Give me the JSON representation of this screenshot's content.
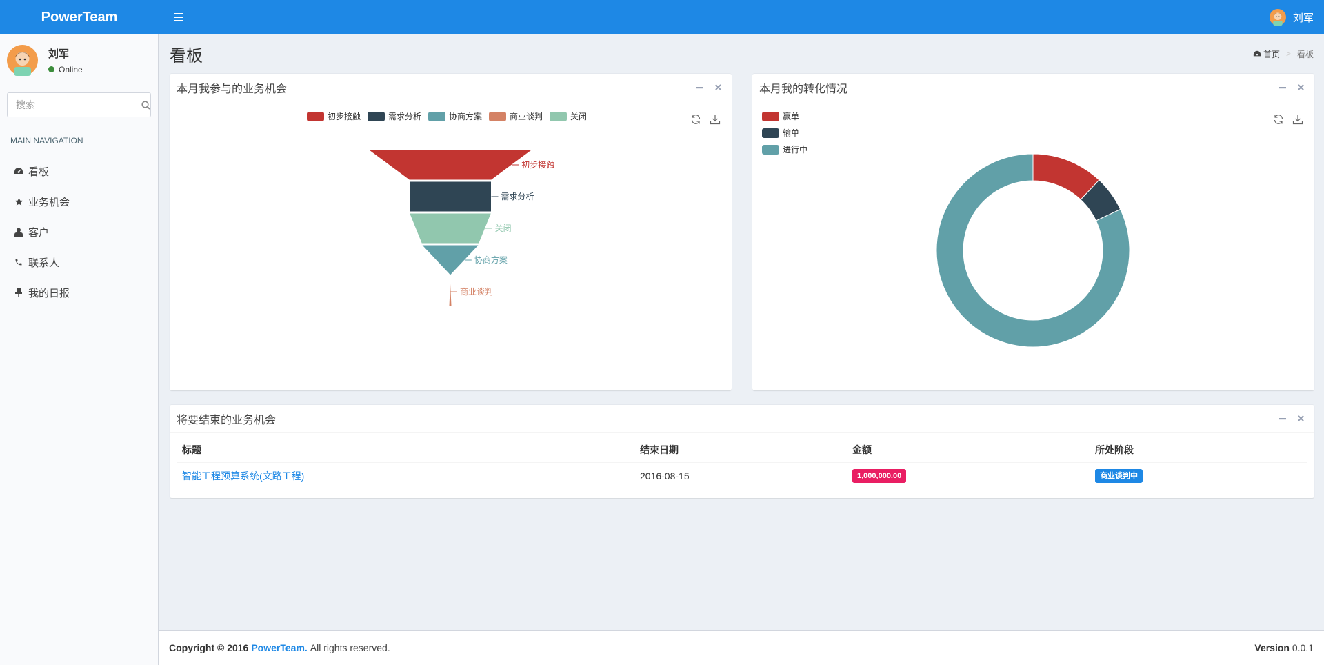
{
  "header": {
    "logo": "PowerTeam",
    "user_name": "刘军"
  },
  "sidebar": {
    "user_name": "刘军",
    "status": "Online",
    "search_placeholder": "搜索",
    "nav_header": "MAIN NAVIGATION",
    "items": [
      {
        "label": "看板",
        "icon": "dashboard-icon"
      },
      {
        "label": "业务机会",
        "icon": "star-icon"
      },
      {
        "label": "客户",
        "icon": "user-icon"
      },
      {
        "label": "联系人",
        "icon": "phone-icon"
      },
      {
        "label": "我的日报",
        "icon": "pin-icon"
      }
    ]
  },
  "content": {
    "title": "看板",
    "breadcrumb_home": "首页",
    "breadcrumb_current": "看板"
  },
  "colors": {
    "primary": "#1e88e5",
    "red": "#c23531",
    "dark": "#2f4554",
    "teal": "#61a0a8",
    "orange": "#d48265",
    "green": "#91c7ae",
    "pink": "#e91e63"
  },
  "funnel_box": {
    "title": "本月我参与的业务机会"
  },
  "donut_box": {
    "title": "本月我的转化情况"
  },
  "chart_data": [
    {
      "type": "funnel",
      "legend": [
        "初步接触",
        "需求分析",
        "协商方案",
        "商业谈判",
        "关闭"
      ],
      "legend_placement": "top-center",
      "stages": [
        {
          "name": "初步接触",
          "value": 100
        },
        {
          "name": "需求分析",
          "value": 50
        },
        {
          "name": "关闭",
          "value": 50
        },
        {
          "name": "协商方案",
          "value": 35
        },
        {
          "name": "商业谈判",
          "value": 0
        }
      ],
      "colors": [
        "#c23531",
        "#2f4554",
        "#91c7ae",
        "#61a0a8",
        "#d48265"
      ]
    },
    {
      "type": "pie",
      "legend": [
        "赢单",
        "输单",
        "进行中"
      ],
      "legend_placement": "top-left",
      "slices": [
        {
          "name": "赢单",
          "value": 12
        },
        {
          "name": "输单",
          "value": 6
        },
        {
          "name": "进行中",
          "value": 82
        }
      ],
      "colors": [
        "#c23531",
        "#2f4554",
        "#61a0a8"
      ]
    }
  ],
  "table_box": {
    "title": "将要结束的业务机会",
    "columns": [
      "标题",
      "结束日期",
      "金额",
      "所处阶段"
    ],
    "rows": [
      {
        "title": "智能工程预算系统(文路工程)",
        "date": "2016-08-15",
        "amount": "1,000,000.00",
        "stage": "商业谈判中"
      }
    ]
  },
  "footer": {
    "copyright": "Copyright © 2016",
    "brand": "PowerTeam.",
    "rights": "All rights reserved.",
    "version_label": "Version",
    "version": "0.0.1"
  }
}
